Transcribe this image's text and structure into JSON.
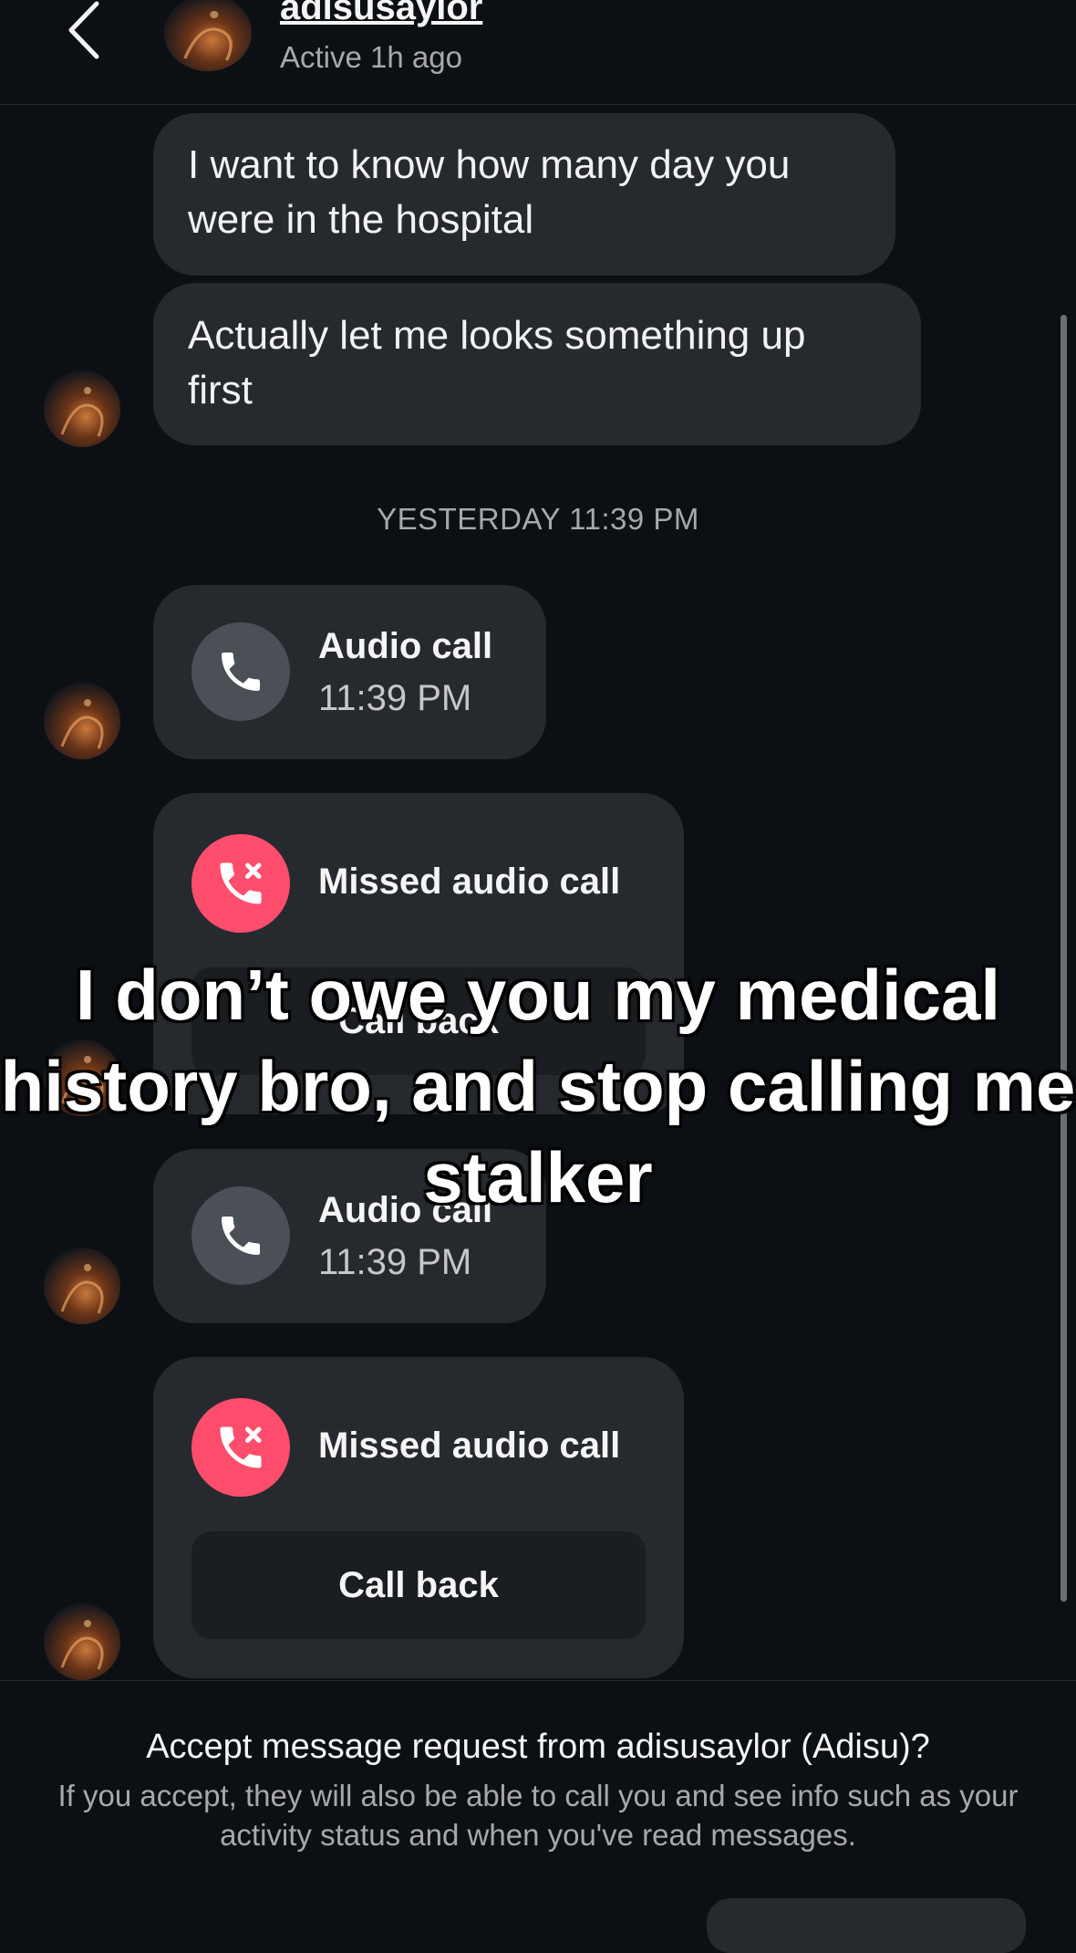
{
  "header": {
    "username": "adisusaylor",
    "status": "Active 1h ago",
    "icons": {
      "back": "chevron-left-icon"
    }
  },
  "messages": [
    {
      "text": "I want to know how many day you were in the hospital"
    },
    {
      "text": "Actually let me looks something up first"
    }
  ],
  "timestamp": "YESTERDAY 11:39 PM",
  "calls": [
    {
      "title": "Audio call",
      "time": "11:39 PM",
      "icon": "phone-icon"
    },
    {
      "title": "Missed audio call",
      "action": "Call back",
      "icon": "missed-call-icon"
    },
    {
      "title": "Audio call",
      "time": "11:39 PM",
      "icon": "phone-icon"
    },
    {
      "title": "Missed audio call",
      "action": "Call back",
      "icon": "missed-call-icon"
    }
  ],
  "overlay_caption": "I don’t owe you my medical history bro, and stop calling me stalker",
  "footer": {
    "title": "Accept message request from adisusaylor (Adisu)?",
    "description": "If you accept, they will also be able to call you and see info such as your activity status and when you've read messages."
  },
  "colors": {
    "background": "#0c1014",
    "bubble": "#262a2f",
    "missed_call": "#ff4d6d",
    "call_icon": "#4b4f56"
  }
}
